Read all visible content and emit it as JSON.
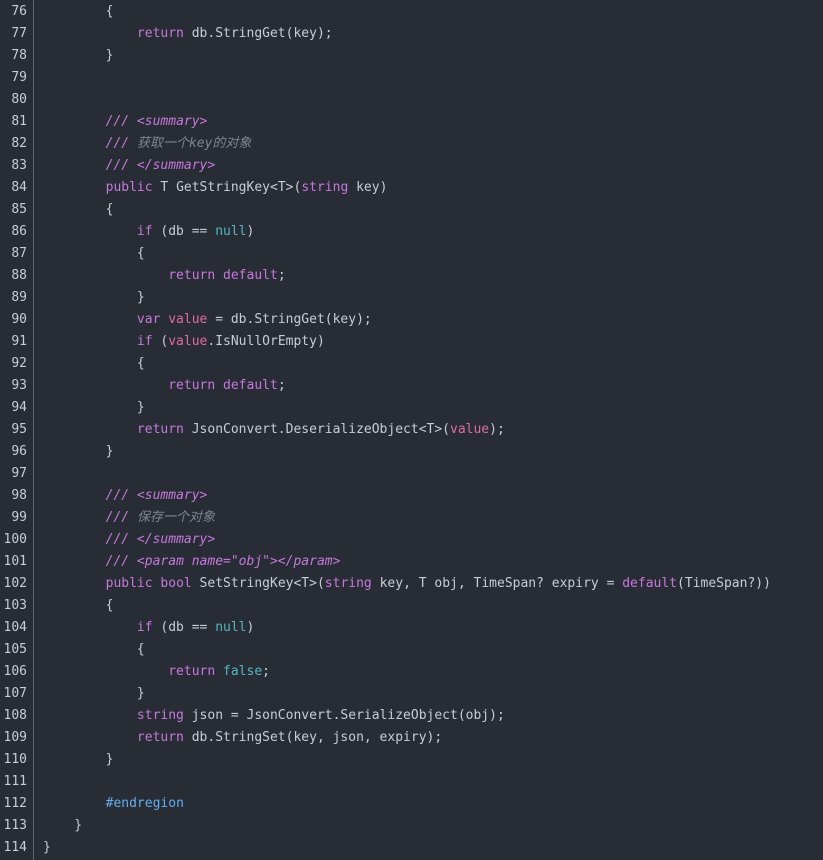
{
  "editor": {
    "lines": [
      {
        "n": "76",
        "tokens": [
          {
            "t": "        {",
            "c": "txt"
          }
        ]
      },
      {
        "n": "77",
        "tokens": [
          {
            "t": "            ",
            "c": "txt"
          },
          {
            "t": "return",
            "c": "kw"
          },
          {
            "t": " db.StringGet(key);",
            "c": "txt"
          }
        ]
      },
      {
        "n": "78",
        "tokens": [
          {
            "t": "        }",
            "c": "txt"
          }
        ]
      },
      {
        "n": "79",
        "tokens": []
      },
      {
        "n": "80",
        "tokens": []
      },
      {
        "n": "81",
        "tokens": [
          {
            "t": "        ",
            "c": "txt"
          },
          {
            "t": "/// <summary>",
            "c": "cm"
          }
        ]
      },
      {
        "n": "82",
        "tokens": [
          {
            "t": "        ",
            "c": "txt"
          },
          {
            "t": "/// ",
            "c": "cm"
          },
          {
            "t": "获取一个key的对象",
            "c": "cmzh"
          }
        ]
      },
      {
        "n": "83",
        "tokens": [
          {
            "t": "        ",
            "c": "txt"
          },
          {
            "t": "/// </summary>",
            "c": "cm"
          }
        ]
      },
      {
        "n": "84",
        "tokens": [
          {
            "t": "        ",
            "c": "txt"
          },
          {
            "t": "public",
            "c": "kw"
          },
          {
            "t": " T GetStringKey<T>(",
            "c": "txt"
          },
          {
            "t": "string",
            "c": "kw"
          },
          {
            "t": " key)",
            "c": "txt"
          }
        ]
      },
      {
        "n": "85",
        "tokens": [
          {
            "t": "        {",
            "c": "txt"
          }
        ]
      },
      {
        "n": "86",
        "tokens": [
          {
            "t": "            ",
            "c": "txt"
          },
          {
            "t": "if",
            "c": "kw"
          },
          {
            "t": " (db == ",
            "c": "txt"
          },
          {
            "t": "null",
            "c": "lit"
          },
          {
            "t": ")",
            "c": "txt"
          }
        ]
      },
      {
        "n": "87",
        "tokens": [
          {
            "t": "            {",
            "c": "txt"
          }
        ]
      },
      {
        "n": "88",
        "tokens": [
          {
            "t": "                ",
            "c": "txt"
          },
          {
            "t": "return",
            "c": "kw"
          },
          {
            "t": " ",
            "c": "txt"
          },
          {
            "t": "default",
            "c": "kw"
          },
          {
            "t": ";",
            "c": "txt"
          }
        ]
      },
      {
        "n": "89",
        "tokens": [
          {
            "t": "            }",
            "c": "txt"
          }
        ]
      },
      {
        "n": "90",
        "tokens": [
          {
            "t": "            ",
            "c": "txt"
          },
          {
            "t": "var",
            "c": "kw"
          },
          {
            "t": " ",
            "c": "txt"
          },
          {
            "t": "value",
            "c": "var"
          },
          {
            "t": " = db.StringGet(key);",
            "c": "txt"
          }
        ]
      },
      {
        "n": "91",
        "tokens": [
          {
            "t": "            ",
            "c": "txt"
          },
          {
            "t": "if",
            "c": "kw"
          },
          {
            "t": " (",
            "c": "txt"
          },
          {
            "t": "value",
            "c": "var"
          },
          {
            "t": ".IsNullOrEmpty)",
            "c": "txt"
          }
        ]
      },
      {
        "n": "92",
        "tokens": [
          {
            "t": "            {",
            "c": "txt"
          }
        ]
      },
      {
        "n": "93",
        "tokens": [
          {
            "t": "                ",
            "c": "txt"
          },
          {
            "t": "return",
            "c": "kw"
          },
          {
            "t": " ",
            "c": "txt"
          },
          {
            "t": "default",
            "c": "kw"
          },
          {
            "t": ";",
            "c": "txt"
          }
        ]
      },
      {
        "n": "94",
        "tokens": [
          {
            "t": "            }",
            "c": "txt"
          }
        ]
      },
      {
        "n": "95",
        "tokens": [
          {
            "t": "            ",
            "c": "txt"
          },
          {
            "t": "return",
            "c": "kw"
          },
          {
            "t": " JsonConvert.DeserializeObject<T>(",
            "c": "txt"
          },
          {
            "t": "value",
            "c": "var"
          },
          {
            "t": ");",
            "c": "txt"
          }
        ]
      },
      {
        "n": "96",
        "tokens": [
          {
            "t": "        }",
            "c": "txt"
          }
        ]
      },
      {
        "n": "97",
        "tokens": []
      },
      {
        "n": "98",
        "tokens": [
          {
            "t": "        ",
            "c": "txt"
          },
          {
            "t": "/// <summary>",
            "c": "cm"
          }
        ]
      },
      {
        "n": "99",
        "tokens": [
          {
            "t": "        ",
            "c": "txt"
          },
          {
            "t": "/// ",
            "c": "cm"
          },
          {
            "t": "保存一个对象",
            "c": "cmzh"
          }
        ]
      },
      {
        "n": "100",
        "tokens": [
          {
            "t": "        ",
            "c": "txt"
          },
          {
            "t": "/// </summary>",
            "c": "cm"
          }
        ]
      },
      {
        "n": "101",
        "tokens": [
          {
            "t": "        ",
            "c": "txt"
          },
          {
            "t": "/// <param name=\"obj\"></param>",
            "c": "cm"
          }
        ]
      },
      {
        "n": "102",
        "tokens": [
          {
            "t": "        ",
            "c": "txt"
          },
          {
            "t": "public",
            "c": "kw"
          },
          {
            "t": " ",
            "c": "txt"
          },
          {
            "t": "bool",
            "c": "kw"
          },
          {
            "t": " SetStringKey<T>(",
            "c": "txt"
          },
          {
            "t": "string",
            "c": "kw"
          },
          {
            "t": " key, T obj, TimeSpan? expiry = ",
            "c": "txt"
          },
          {
            "t": "default",
            "c": "kw"
          },
          {
            "t": "(TimeSpan?))",
            "c": "txt"
          }
        ]
      },
      {
        "n": "103",
        "tokens": [
          {
            "t": "        {",
            "c": "txt"
          }
        ]
      },
      {
        "n": "104",
        "tokens": [
          {
            "t": "            ",
            "c": "txt"
          },
          {
            "t": "if",
            "c": "kw"
          },
          {
            "t": " (db == ",
            "c": "txt"
          },
          {
            "t": "null",
            "c": "lit"
          },
          {
            "t": ")",
            "c": "txt"
          }
        ]
      },
      {
        "n": "105",
        "tokens": [
          {
            "t": "            {",
            "c": "txt"
          }
        ]
      },
      {
        "n": "106",
        "tokens": [
          {
            "t": "                ",
            "c": "txt"
          },
          {
            "t": "return",
            "c": "kw"
          },
          {
            "t": " ",
            "c": "txt"
          },
          {
            "t": "false",
            "c": "lit"
          },
          {
            "t": ";",
            "c": "txt"
          }
        ]
      },
      {
        "n": "107",
        "tokens": [
          {
            "t": "            }",
            "c": "txt"
          }
        ]
      },
      {
        "n": "108",
        "tokens": [
          {
            "t": "            ",
            "c": "txt"
          },
          {
            "t": "string",
            "c": "kw"
          },
          {
            "t": " json = JsonConvert.SerializeObject(obj);",
            "c": "txt"
          }
        ]
      },
      {
        "n": "109",
        "tokens": [
          {
            "t": "            ",
            "c": "txt"
          },
          {
            "t": "return",
            "c": "kw"
          },
          {
            "t": " db.StringSet(key, json, expiry);",
            "c": "txt"
          }
        ]
      },
      {
        "n": "110",
        "tokens": [
          {
            "t": "        }",
            "c": "txt"
          }
        ]
      },
      {
        "n": "111",
        "tokens": []
      },
      {
        "n": "112",
        "tokens": [
          {
            "t": "        ",
            "c": "txt"
          },
          {
            "t": "#endregion",
            "c": "dir"
          }
        ]
      },
      {
        "n": "113",
        "tokens": [
          {
            "t": "    }",
            "c": "txt"
          }
        ]
      },
      {
        "n": "114",
        "tokens": [
          {
            "t": "}",
            "c": "txt"
          }
        ]
      }
    ]
  }
}
